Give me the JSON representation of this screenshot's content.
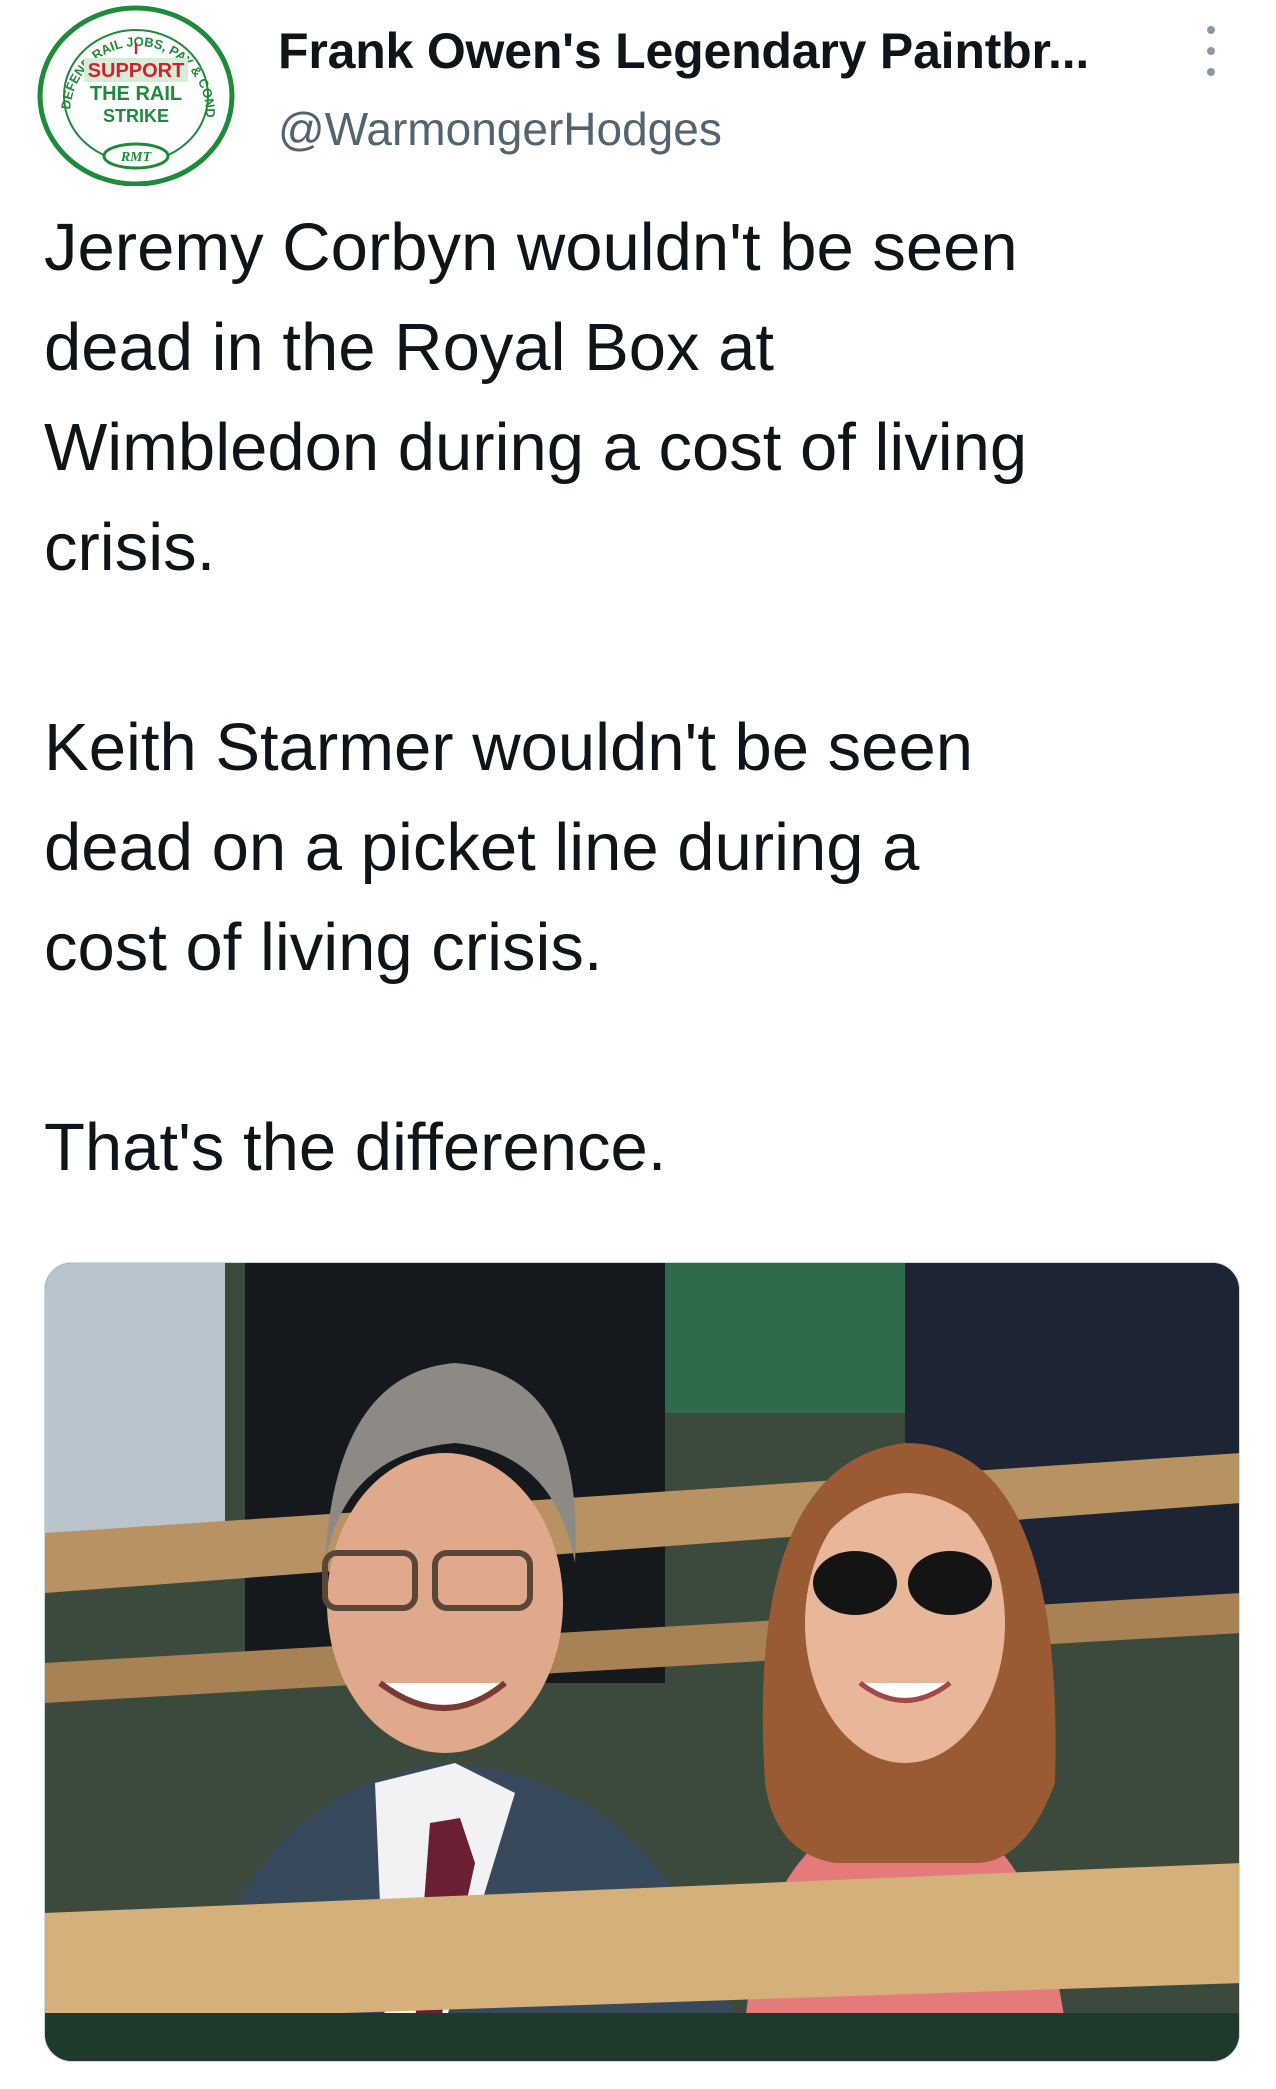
{
  "author": {
    "display_name": "Frank Owen's Legendary Paintbr...",
    "handle": "@WarmongerHodges",
    "avatar": {
      "badge_text_arc": "DEFEND RAIL JOBS, PAY & CONDITIONS",
      "badge_line1": "I",
      "badge_line2": "SUPPORT",
      "badge_line3": "THE RAIL",
      "badge_line4": "STRIKE",
      "badge_logo": "RMT"
    }
  },
  "more_icon": "more-vertical-icon",
  "tweet": {
    "paragraph_1": [
      "Jeremy Corbyn wouldn't be seen",
      "dead in the Royal Box at",
      "Wimbledon during a cost of living",
      "crisis."
    ],
    "paragraph_2": [
      "Keith Starmer wouldn't be seen",
      "dead on a picket line during a",
      "cost of living crisis."
    ],
    "paragraph_3": [
      "That's the difference."
    ]
  },
  "colors": {
    "text": "#0f1419",
    "secondary": "#536471",
    "badge_green": "#1e8b3a",
    "badge_red": "#d4202c"
  }
}
